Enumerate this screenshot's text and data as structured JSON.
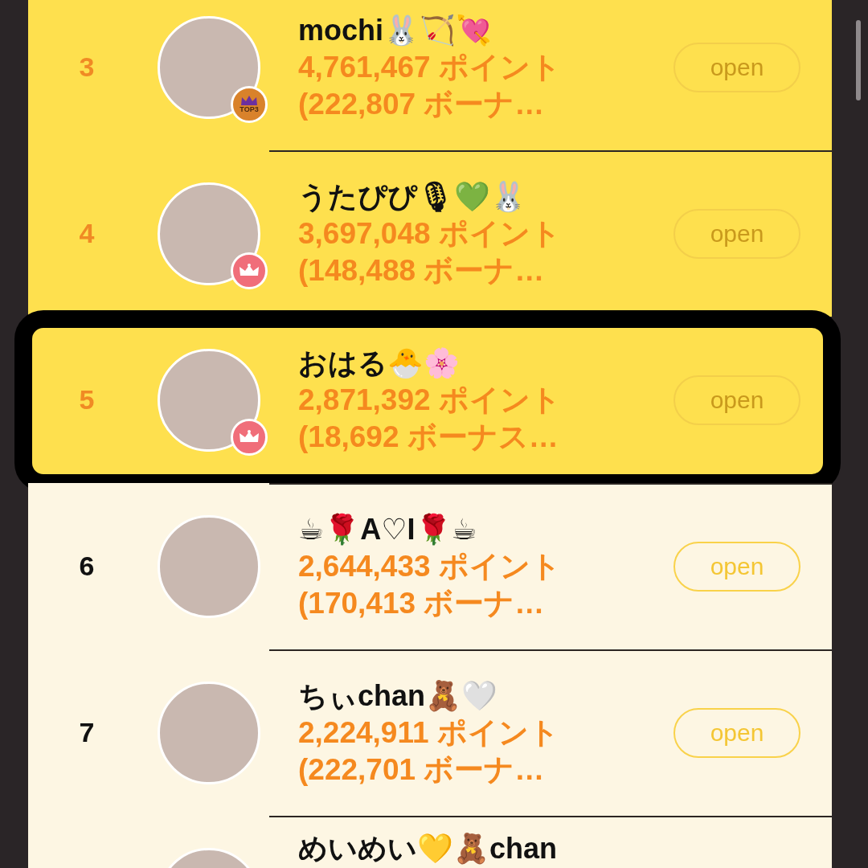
{
  "rows": [
    {
      "rank": "3",
      "highlighted": true,
      "current": false,
      "name": "mochi🐰🏹💘",
      "points": "4,761,467 ポイント",
      "bonus": "(222,807 ボーナ…",
      "badge": {
        "kind": "top3",
        "label": "TOP3"
      },
      "button": {
        "label": "open",
        "disabled": true
      }
    },
    {
      "rank": "4",
      "highlighted": true,
      "current": false,
      "name": "うたぴぴ🎙💚🐰",
      "points": "3,697,048 ポイント",
      "bonus": "(148,488 ボーナ…",
      "badge": {
        "kind": "crown"
      },
      "button": {
        "label": "open",
        "disabled": true
      }
    },
    {
      "rank": "5",
      "highlighted": true,
      "current": true,
      "name": "おはる🐣🌸",
      "points": "2,871,392 ポイント",
      "bonus": "(18,692 ボーナス…",
      "badge": {
        "kind": "crown"
      },
      "button": {
        "label": "open",
        "disabled": true
      }
    },
    {
      "rank": "6",
      "highlighted": false,
      "current": false,
      "name": "☕🌹A♡I🌹☕",
      "points": "2,644,433 ポイント",
      "bonus": "(170,413 ボーナ…",
      "button": {
        "label": "open",
        "disabled": false
      }
    },
    {
      "rank": "7",
      "highlighted": false,
      "current": false,
      "name": "ちぃchan🧸🤍",
      "points": "2,224,911 ポイント",
      "bonus": "(222,701 ボーナ…",
      "button": {
        "label": "open",
        "disabled": false
      }
    },
    {
      "highlighted": false,
      "current": false,
      "name": "めいめい💛🧸chan"
    }
  ]
}
